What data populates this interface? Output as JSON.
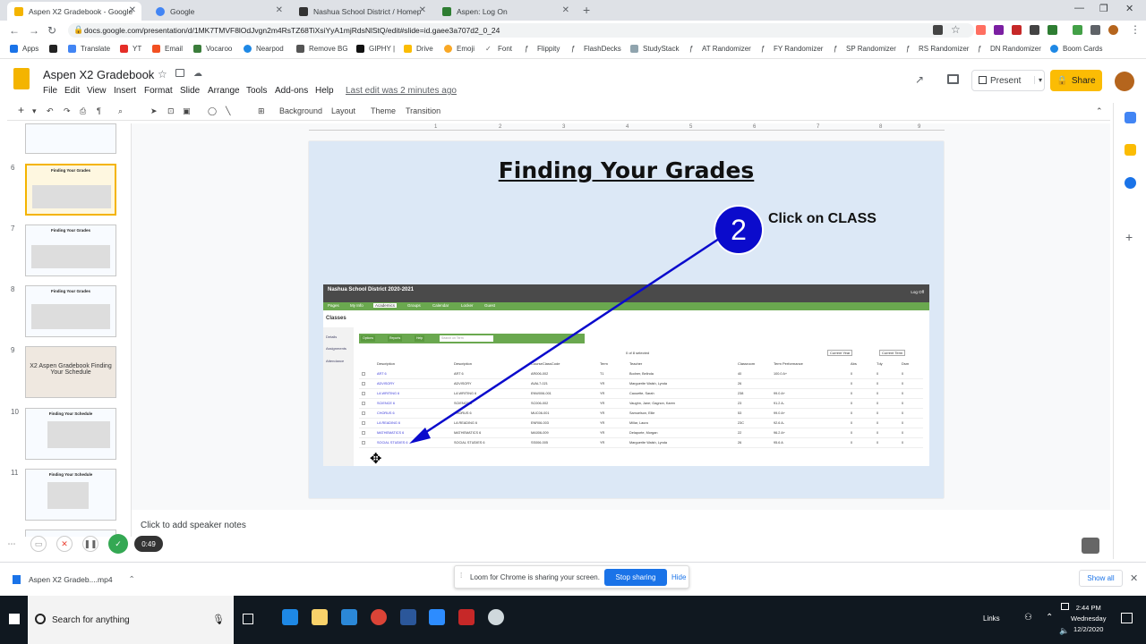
{
  "browser": {
    "tabs": [
      {
        "label": "Aspen X2 Gradebook - Google S",
        "color": "#f4b400"
      },
      {
        "label": "Google",
        "color": "#4285f4"
      },
      {
        "label": "Nashua School District / Homep",
        "color": "#333333"
      },
      {
        "label": "Aspen: Log On",
        "color": "#2e7d32"
      }
    ],
    "url": "docs.google.com/presentation/d/1MK7TMVF8lOdJvgn2m4RsTZ68TiXsiYyA1mjRdsNlStQ/edit#slide=id.gaee3a707d2_0_24",
    "bookmarks": [
      "Apps",
      "YT",
      "Translate",
      "YT",
      "Email",
      "Vocaroo",
      "Nearpod",
      "Remove BG",
      "GIPHY |",
      "Drive",
      "Emoji",
      "Font",
      "Flippity",
      "FlashDecks",
      "StudyStack",
      "AT Randomizer",
      "FY Randomizer",
      "SP Randomizer",
      "RS Randomizer",
      "DN Randomizer",
      "Boom Cards"
    ]
  },
  "slides_app": {
    "title": "Aspen X2 Gradebook",
    "menus": [
      "File",
      "Edit",
      "View",
      "Insert",
      "Format",
      "Slide",
      "Arrange",
      "Tools",
      "Add-ons",
      "Help"
    ],
    "last_edit": "Last edit was 2 minutes ago",
    "present_label": "Present",
    "share_label": "Share",
    "toolbar": {
      "background": "Background",
      "layout": "Layout",
      "theme": "Theme",
      "transition": "Transition"
    },
    "ruler_ticks": [
      "1",
      "2",
      "3",
      "4",
      "5",
      "6",
      "7",
      "8",
      "9"
    ]
  },
  "filmstrip": {
    "slides": [
      {
        "num": "",
        "title": ""
      },
      {
        "num": "6",
        "title": "Finding Your Grades"
      },
      {
        "num": "7",
        "title": "Finding Your Grades"
      },
      {
        "num": "8",
        "title": "Finding Your Grades"
      },
      {
        "num": "9",
        "title": "X2 Aspen Gradebook Finding Your Schedule"
      },
      {
        "num": "10",
        "title": "Finding Your Schedule"
      },
      {
        "num": "11",
        "title": "Finding Your Schedule"
      },
      {
        "num": "12",
        "title": ""
      }
    ]
  },
  "slide": {
    "title": "Finding Your Grades",
    "step_number": "2",
    "step_label": "Click on CLASS",
    "embedded": {
      "district": "Nashua School District 2020-2021",
      "log_off": "Log Off",
      "nav": [
        "Pages",
        "My Info",
        "Academics",
        "Groups",
        "Calendar",
        "Locker",
        "Guest"
      ],
      "section": "Classes",
      "side": [
        "Details",
        "Assignments",
        "Attendance"
      ],
      "buttons": [
        "Options",
        "Reports",
        "Help",
        "Search on Term"
      ],
      "selected": "0 of 8 selected",
      "filters": [
        "Current Year",
        "Current Term"
      ],
      "headers": [
        "Description",
        "Description",
        "CourseClassCode",
        "Term",
        "Teacher",
        "Classroom",
        "Term Performance",
        "Abs",
        "Tdy",
        "Dsm"
      ],
      "rows": [
        [
          "ART 6",
          "ART 6",
          "AR006-002",
          "T1",
          "Bodner, Belinda",
          "40",
          "100.0 A+",
          "0",
          "0",
          "0"
        ],
        [
          "ADVISORY",
          "ADVISORY",
          "AVAL7-021",
          "YR",
          "Marguerite Walsh, Lynda",
          "26",
          "",
          "0",
          "0",
          "0"
        ],
        [
          "LA WRITING 6",
          "LA WRITING 6",
          "ENW006-001",
          "YR",
          "Caouette, Sarah",
          "238",
          "99.0 A+",
          "0",
          "0",
          "0"
        ],
        [
          "SCIENCE 6",
          "SCIENCE 6",
          "SC006-002",
          "YR",
          "Vaughn, Jane; Gagnon, Karen",
          "23",
          "91.2 A-",
          "0",
          "0",
          "0"
        ],
        [
          "CHORUS 6",
          "CHORUS 6",
          "MUC06-001",
          "YR",
          "Samuelson, Ellie",
          "53",
          "99.0 A+",
          "0",
          "0",
          "0"
        ],
        [
          "LA READING 6",
          "LA READING 6",
          "ENR06-003",
          "YR",
          "Millar, Laura",
          "23C",
          "92.6 A-",
          "0",
          "0",
          "0"
        ],
        [
          "MATHEMATICS 6",
          "MATHEMATICS 6",
          "MA006-009",
          "YR",
          "Delaporte, Morgan",
          "22",
          "96.2 A+",
          "0",
          "0",
          "0"
        ],
        [
          "SOCIAL STUDIES 6",
          "SOCIAL STUDIES 6",
          "SS006-005",
          "YR",
          "Marguerite Walsh, Lynda",
          "26",
          "95.6 A",
          "0",
          "0",
          "0"
        ]
      ]
    }
  },
  "notes_placeholder": "Click to add speaker notes",
  "loom": {
    "timer": "0:49",
    "banner_text": "Loom for Chrome is sharing your screen.",
    "stop_sharing": "Stop sharing",
    "hide": "Hide"
  },
  "download": {
    "file": "Aspen X2 Gradeb....mp4",
    "show_all": "Show all"
  },
  "taskbar": {
    "search_placeholder": "Search for anything",
    "links": "Links",
    "time": "2:44 PM",
    "day": "Wednesday",
    "date": "12/2/2020"
  },
  "colors": {
    "accent_yellow": "#fbbc04",
    "step_blue": "#0b0bcc",
    "aspen_green": "#6aa84f",
    "arrow_blue": "#0a0acc"
  }
}
